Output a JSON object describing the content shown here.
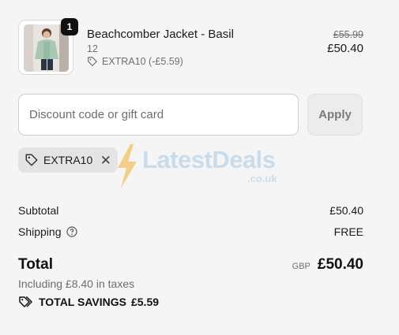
{
  "product": {
    "title": "Beachcomber Jacket - Basil",
    "variant": "12",
    "discount_line": "EXTRA10 (-£5.59)",
    "quantity": "1",
    "compare_price": "£55.99",
    "price": "£50.40",
    "image_icon": "product-photo"
  },
  "discount": {
    "placeholder": "Discount code or gift card",
    "value": "",
    "apply_label": "Apply",
    "applied_code": "EXTRA10",
    "remove_icon": "close-icon"
  },
  "watermark": {
    "text": "LatestDeals",
    "sub": ".co.uk"
  },
  "summary": {
    "subtotal_label": "Subtotal",
    "subtotal_value": "£50.40",
    "shipping_label": "Shipping",
    "shipping_value": "FREE",
    "total_label": "Total",
    "currency": "GBP",
    "total_value": "£50.40",
    "taxes_note": "Including £8.40 in taxes",
    "savings_label": "TOTAL SAVINGS",
    "savings_value": "£5.59"
  },
  "colors": {
    "background": "#f5f5f5",
    "pill": "#e4e4e4",
    "muted_text": "#707070",
    "watermark": "#c9dcec",
    "bolt": "#f2c66a"
  }
}
